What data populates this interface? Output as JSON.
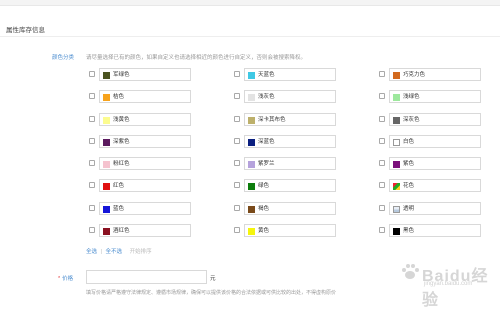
{
  "section": {
    "title": "属性库存信息"
  },
  "color": {
    "label": "颜色分类",
    "hint": "请尽量选择已有的颜色，如果自定义也请选择相近的颜色进行自定义，否则会被搜索降权。"
  },
  "colors": [
    [
      {
        "name": "军绿色",
        "color": "#4b5320"
      },
      {
        "name": "天蓝色",
        "color": "#3fc8e4"
      },
      {
        "name": "巧克力色",
        "color": "#d2691e"
      }
    ],
    [
      {
        "name": "桔色",
        "color": "#f7a31c"
      },
      {
        "name": "浅灰色",
        "color": "#e3e3e3"
      },
      {
        "name": "浅绿色",
        "color": "#9de89d"
      }
    ],
    [
      {
        "name": "浅黄色",
        "color": "#fcfc8f"
      },
      {
        "name": "深卡其布色",
        "color": "#bdb06b"
      },
      {
        "name": "深灰色",
        "color": "#666666"
      }
    ],
    [
      {
        "name": "深紫色",
        "color": "#5b1a5e"
      },
      {
        "name": "深蓝色",
        "color": "#0b1f80"
      },
      {
        "name": "白色",
        "color": "#ffffff",
        "outlined": true
      }
    ],
    [
      {
        "name": "粉红色",
        "color": "#f5c3cf"
      },
      {
        "name": "紫罗兰",
        "color": "#b5a2dc"
      },
      {
        "name": "紫色",
        "color": "#7a0f7a"
      }
    ],
    [
      {
        "name": "红色",
        "color": "#e01010"
      },
      {
        "name": "绿色",
        "color": "#0d7d0d"
      },
      {
        "name": "花色",
        "color": "#e8a23a",
        "multi": true
      }
    ],
    [
      {
        "name": "蓝色",
        "color": "#1515d8"
      },
      {
        "name": "褐色",
        "color": "#7a4a1a"
      },
      {
        "name": "透明",
        "color": "#c9d7e8",
        "outlined": true
      }
    ],
    [
      {
        "name": "酒红色",
        "color": "#8a1020"
      },
      {
        "name": "黄色",
        "color": "#f5f50d"
      },
      {
        "name": "黑色",
        "color": "#000000"
      }
    ]
  ],
  "actions": {
    "select_all": "全选",
    "separator": "|",
    "deselect_all": "全不选",
    "sort": "开始排序"
  },
  "price": {
    "required_mark": "*",
    "label": "价格",
    "value": "",
    "unit": "元",
    "note": "填写价格请严格遵守法律规定、遵循市场规律，确保可以提供该价格的合法依据或可供比较的出处，不得虚构原价"
  },
  "watermark": {
    "text": "Baidu经验",
    "sub": "jingyan.baidu.com"
  }
}
